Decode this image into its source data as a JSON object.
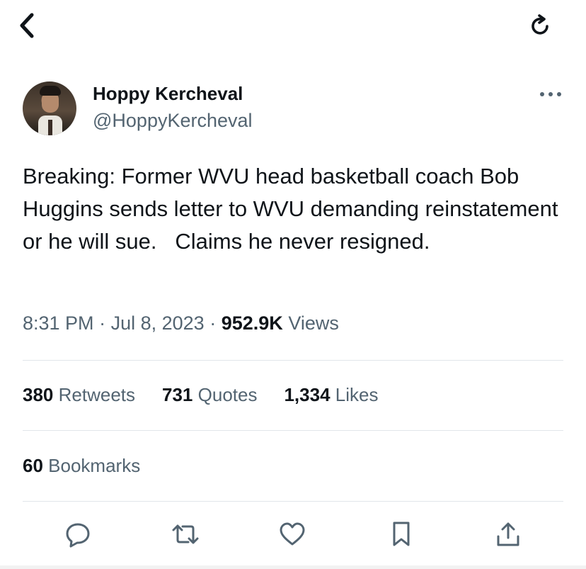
{
  "header": {
    "back_icon": "chevron-left-icon",
    "refresh_icon": "refresh-icon"
  },
  "author": {
    "display_name": "Hoppy Kercheval",
    "handle": "@HoppyKercheval"
  },
  "tweet": {
    "text": "Breaking: Former WVU head basketball coach Bob Huggins sends letter to WVU demanding reinstatement or he will sue.   Claims he never resigned.",
    "time": "8:31 PM",
    "date": "Jul 8, 2023",
    "views_count": "952.9K",
    "views_label": "Views",
    "separator": "·"
  },
  "stats": {
    "retweets": {
      "count": "380",
      "label": "Retweets"
    },
    "quotes": {
      "count": "731",
      "label": "Quotes"
    },
    "likes": {
      "count": "1,334",
      "label": "Likes"
    },
    "bookmarks": {
      "count": "60",
      "label": "Bookmarks"
    }
  },
  "actions": [
    "reply-icon",
    "retweet-icon",
    "like-icon",
    "bookmark-icon",
    "share-icon"
  ],
  "colors": {
    "text": "#0f1419",
    "secondary": "#536471",
    "divider": "#e1e6ea"
  }
}
